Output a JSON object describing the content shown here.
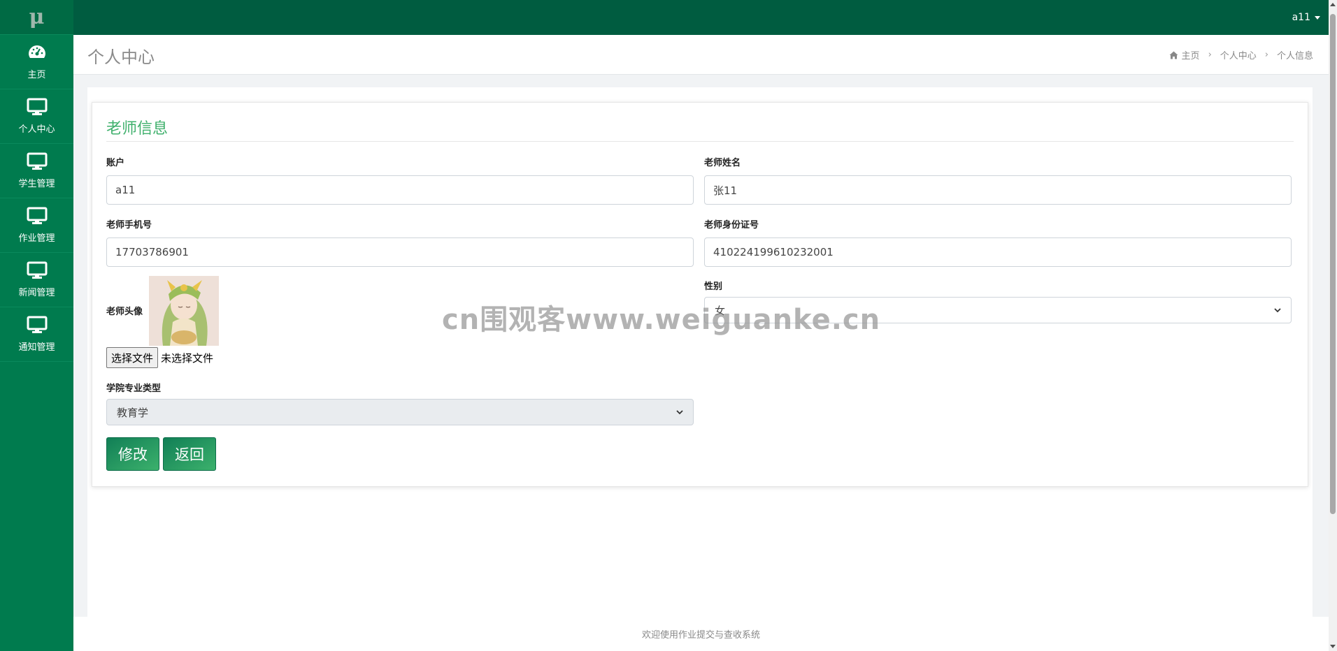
{
  "app": {
    "logo": "μ",
    "user": "a11"
  },
  "colors": {
    "sidebar": "#007b4e",
    "topbar": "#005c40",
    "accent": "#3fb06c"
  },
  "sidebar": {
    "items": [
      {
        "label": "主页",
        "icon": "dashboard-icon"
      },
      {
        "label": "个人中心",
        "icon": "monitor-icon"
      },
      {
        "label": "学生管理",
        "icon": "monitor-icon"
      },
      {
        "label": "作业管理",
        "icon": "monitor-icon"
      },
      {
        "label": "新闻管理",
        "icon": "monitor-icon"
      },
      {
        "label": "通知管理",
        "icon": "monitor-icon"
      }
    ]
  },
  "header": {
    "title": "个人中心",
    "breadcrumb": [
      "主页",
      "个人中心",
      "个人信息"
    ]
  },
  "form": {
    "title": "老师信息",
    "account_label": "账户",
    "account_value": "a11",
    "name_label": "老师姓名",
    "name_value": "张11",
    "phone_label": "老师手机号",
    "phone_value": "17703786901",
    "id_label": "老师身份证号",
    "id_value": "410224199610232001",
    "avatar_label": "老师头像",
    "file_button": "选择文件",
    "file_status": "未选择文件",
    "gender_label": "性别",
    "gender_value": "女",
    "major_label": "学院专业类型",
    "major_value": "教育学",
    "submit_label": "修改",
    "back_label": "返回"
  },
  "watermark": "cn围观客www.weiguanke.cn",
  "footer": "欢迎使用作业提交与查收系统"
}
